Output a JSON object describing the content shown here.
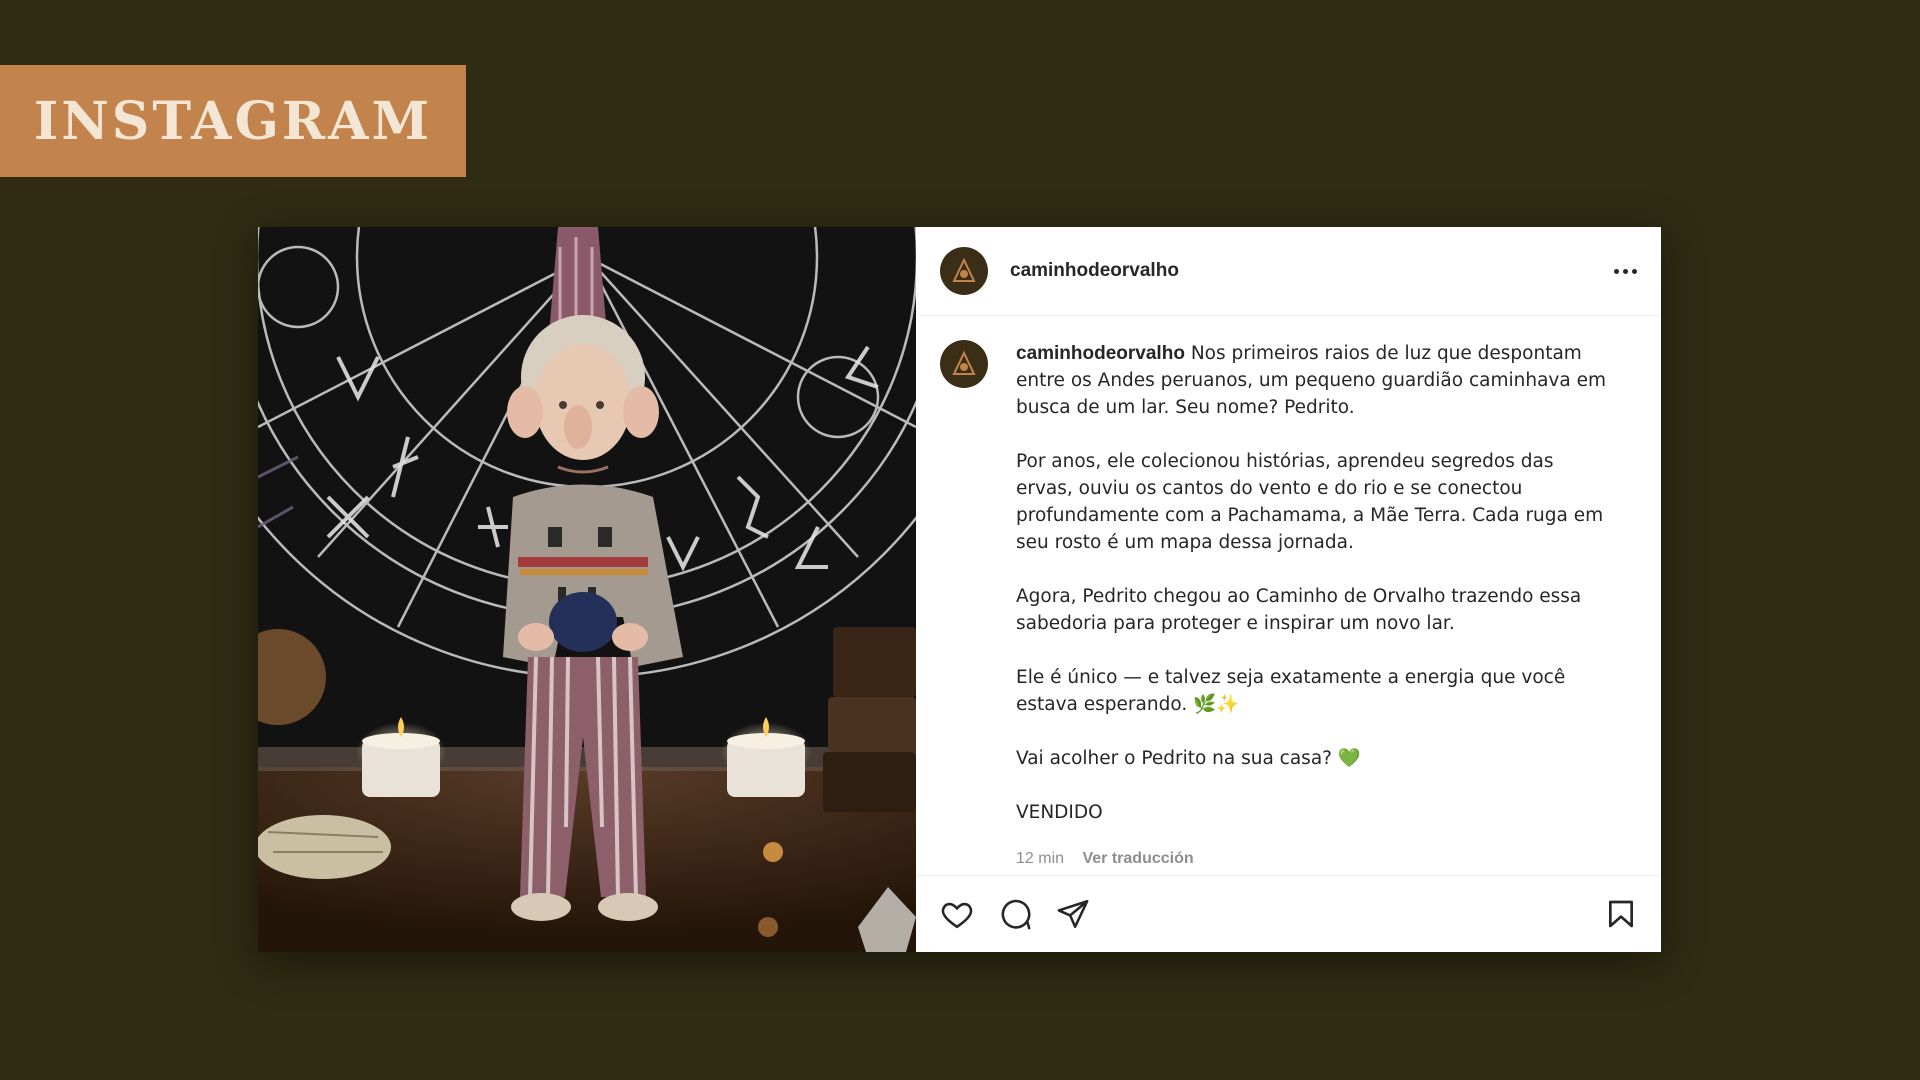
{
  "banner": {
    "title": "INSTAGRAM"
  },
  "post": {
    "username": "caminhodeorvalho",
    "caption": {
      "username": "caminhodeorvalho",
      "p1": "Nos primeiros raios de luz que despontam entre os Andes peruanos, um pequeno guardião caminhava em busca de um lar. Seu nome? Pedrito.",
      "p2": "Por anos, ele colecionou histórias, aprendeu segredos das ervas, ouviu os cantos do vento e do rio e se conectou profundamente com a Pachamama, a Mãe Terra. Cada ruga em seu rosto é um mapa dessa jornada.",
      "p3": "Agora, Pedrito chegou ao Caminho de Orvalho trazendo essa sabedoria para proteger e inspirar um novo lar.",
      "p4": "Ele é único — e talvez seja exatamente a energia que você estava esperando. 🌿✨",
      "p5": "Vai acolher o Pedrito na sua casa? 💚",
      "p6": "VENDIDO"
    },
    "time": "12 min",
    "translate": "Ver traducción",
    "icons": [
      "heart-icon",
      "comment-icon",
      "share-icon",
      "bookmark-icon",
      "more-icon"
    ]
  },
  "colors": {
    "background": "#2f2c13",
    "banner": "#c2834d",
    "banner_text": "#f3e6d4"
  }
}
